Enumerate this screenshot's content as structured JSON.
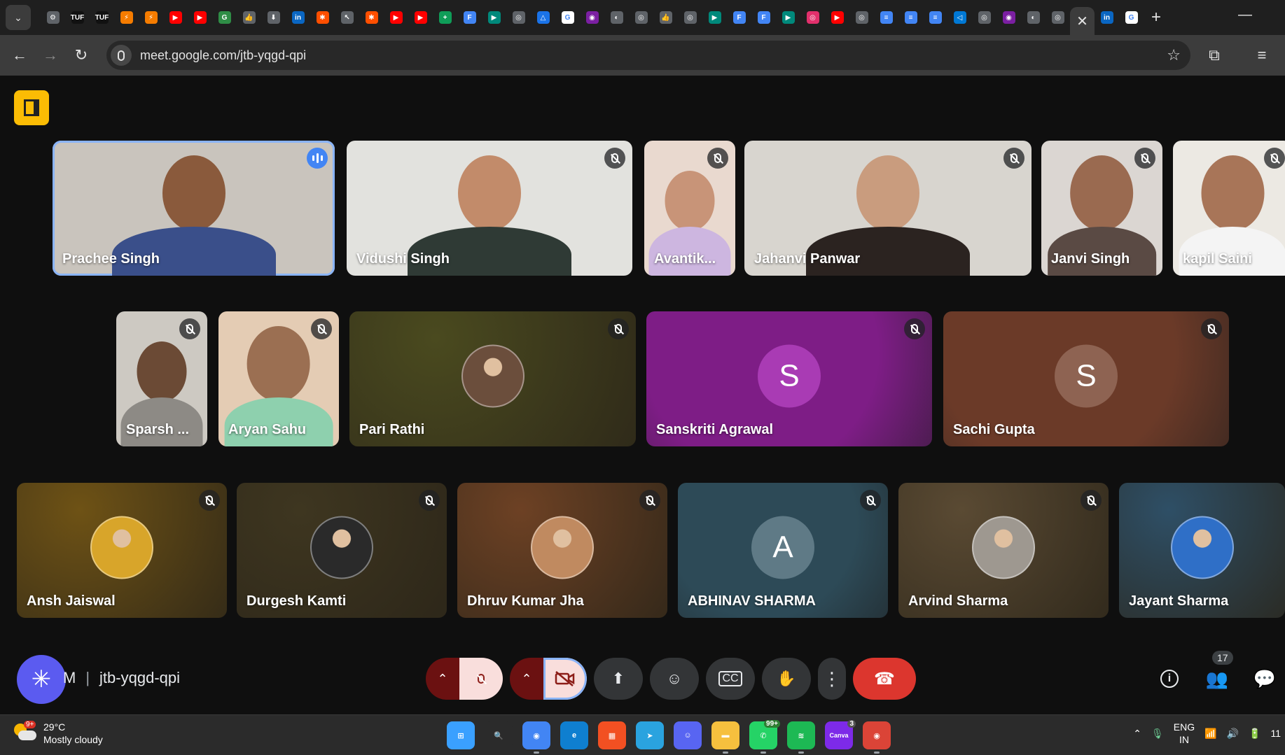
{
  "browser": {
    "tabs": [
      {
        "icon": "aperture-icon",
        "color": "#5f6368",
        "text": "⚙"
      },
      {
        "icon": "tuf-icon",
        "color": "#111111",
        "text": "TUF"
      },
      {
        "icon": "tuf-icon",
        "color": "#111111",
        "text": "TUF"
      },
      {
        "icon": "flow-icon",
        "color": "#f57c00",
        "text": "⚡"
      },
      {
        "icon": "flow-icon",
        "color": "#f57c00",
        "text": "⚡"
      },
      {
        "icon": "youtube-icon",
        "color": "#ff0000",
        "text": "▶"
      },
      {
        "icon": "youtube-icon",
        "color": "#ff0000",
        "text": "▶"
      },
      {
        "icon": "gfg-icon",
        "color": "#2f8d46",
        "text": "G"
      },
      {
        "icon": "thumbs-icon",
        "color": "#5f6368",
        "text": "👍"
      },
      {
        "icon": "download-icon",
        "color": "#5f6368",
        "text": "⬇"
      },
      {
        "icon": "linkedin-icon",
        "color": "#0a66c2",
        "text": "in"
      },
      {
        "icon": "zapier-icon",
        "color": "#ff4f00",
        "text": "✱"
      },
      {
        "icon": "cursor-icon",
        "color": "#5f6368",
        "text": "↖"
      },
      {
        "icon": "zapier-icon",
        "color": "#ff4f00",
        "text": "✱"
      },
      {
        "icon": "youtube-icon",
        "color": "#ff0000",
        "text": "▶"
      },
      {
        "icon": "youtube-icon",
        "color": "#ff0000",
        "text": "▶"
      },
      {
        "icon": "sheets-plus-icon",
        "color": "#0f9d58",
        "text": "+"
      },
      {
        "icon": "forms-icon",
        "color": "#4285f4",
        "text": "F"
      },
      {
        "icon": "meet-icon",
        "color": "#00897b",
        "text": "▶"
      },
      {
        "icon": "chatgpt-icon",
        "color": "#5f6368",
        "text": "◎"
      },
      {
        "icon": "drive-icon",
        "color": "#1a73e8",
        "text": "△"
      },
      {
        "icon": "google-icon",
        "color": "#ffffff",
        "text": "G"
      },
      {
        "icon": "circle-icon",
        "color": "#7b1fa2",
        "text": "◉"
      },
      {
        "icon": "globe-icon",
        "color": "#5f6368",
        "text": "◐"
      },
      {
        "icon": "chatgpt-icon",
        "color": "#5f6368",
        "text": "◎"
      },
      {
        "icon": "thumbs-icon",
        "color": "#5f6368",
        "text": "👍"
      },
      {
        "icon": "chatgpt-icon",
        "color": "#5f6368",
        "text": "◎"
      },
      {
        "icon": "meet-icon",
        "color": "#00897b",
        "text": "▶"
      },
      {
        "icon": "forms-icon",
        "color": "#4285f4",
        "text": "F"
      },
      {
        "icon": "forms-icon",
        "color": "#4285f4",
        "text": "F"
      },
      {
        "icon": "meet-icon",
        "color": "#00897b",
        "text": "▶"
      },
      {
        "icon": "instagram-icon",
        "color": "#e1306c",
        "text": "◎"
      },
      {
        "icon": "youtube-icon",
        "color": "#ff0000",
        "text": "▶"
      },
      {
        "icon": "chatgpt-icon",
        "color": "#5f6368",
        "text": "◎"
      },
      {
        "icon": "docs-icon",
        "color": "#4285f4",
        "text": "≡"
      },
      {
        "icon": "docs-icon",
        "color": "#4285f4",
        "text": "≡"
      },
      {
        "icon": "docs-icon",
        "color": "#4285f4",
        "text": "≡"
      },
      {
        "icon": "vscode-icon",
        "color": "#0078d4",
        "text": "◁"
      },
      {
        "icon": "chatgpt-icon",
        "color": "#5f6368",
        "text": "◎"
      },
      {
        "icon": "circle-icon",
        "color": "#7b1fa2",
        "text": "◉"
      },
      {
        "icon": "globe-icon",
        "color": "#5f6368",
        "text": "◐"
      },
      {
        "icon": "chatgpt-icon",
        "color": "#5f6368",
        "text": "◎"
      }
    ],
    "active_tab_close": "✕",
    "after_tabs": [
      {
        "icon": "linkedin-icon",
        "color": "#0a66c2",
        "text": "in"
      },
      {
        "icon": "google-icon",
        "color": "#ffffff",
        "text": "G"
      }
    ],
    "new_tab": "+",
    "minimize": "—",
    "url": "meet.google.com/jtb-yqgd-qpi"
  },
  "meet": {
    "row1": [
      {
        "name": "Prachee Singh",
        "speaking": true,
        "bg": "#c9c4bd",
        "skin": "#8a5a3c",
        "shirt": "#3a4f8a"
      },
      {
        "name": "Vidushi Singh",
        "muted": true,
        "bg": "#e2e2de",
        "skin": "#c28b6a",
        "shirt": "#2f3a35"
      },
      {
        "name": "Avantik...",
        "muted": true,
        "bg": "#e9d9cf",
        "skin": "#c89478",
        "shirt": "#cdb6e0"
      },
      {
        "name": "Jahanvi Panwar",
        "muted": true,
        "bg": "#d8d5cf",
        "skin": "#c99c7e",
        "shirt": "#2b2320"
      },
      {
        "name": "Janvi Singh",
        "muted": true,
        "bg": "#dbd6d2",
        "skin": "#9a6a50",
        "shirt": "#5a4a44"
      },
      {
        "name": "kapil Saini",
        "muted": true,
        "bg": "#ece9e3",
        "skin": "#a87558",
        "shirt": "#f4f4f4"
      }
    ],
    "row2": [
      {
        "name": "Sparsh ...",
        "muted": true,
        "bg": "#cdc9c2",
        "skin": "#6b4a35",
        "shirt": "#8d8a85"
      },
      {
        "name": "Aryan Sahu",
        "muted": true,
        "bg": "#e4ccb4",
        "skin": "#9b6f52",
        "shirt": "#8ed0ae"
      },
      {
        "name": "Pari Rathi",
        "muted": true,
        "bg": "#4a4a1f",
        "avatar": "photo",
        "avatar_color": "#6b4e3c"
      },
      {
        "name": "Sanskriti Agrawal",
        "muted": true,
        "bg": "#7e1d86",
        "letter": "S",
        "letter_bg": "#a93bb4"
      },
      {
        "name": "Sachi Gupta",
        "muted": true,
        "bg": "#6b3a28",
        "letter": "S",
        "letter_bg": "#8e6352"
      }
    ],
    "row3": [
      {
        "name": "Ansh Jaiswal",
        "muted": true,
        "bg": "#6e5215",
        "avatar": "photo",
        "avatar_color": "#d8a52a"
      },
      {
        "name": "Durgesh Kamti",
        "muted": true,
        "bg": "#3e3620",
        "avatar": "photo",
        "avatar_color": "#2a2a2a"
      },
      {
        "name": "Dhruv Kumar Jha",
        "muted": true,
        "bg": "#6d4124",
        "avatar": "photo",
        "avatar_color": "#c08a60"
      },
      {
        "name": "ABHINAV SHARMA",
        "muted": true,
        "bg": "#2d4a57",
        "letter": "A",
        "letter_bg": "#5f7a86"
      },
      {
        "name": "Arvind Sharma",
        "muted": true,
        "bg": "#5a4a33",
        "avatar": "photo",
        "avatar_color": "#9e9890"
      },
      {
        "name": "Jayant Sharma",
        "bg": "#2e4f66",
        "avatar": "photo",
        "avatar_color": "#2f6fc7"
      }
    ],
    "meeting_code": "jtb-yqgd-qpi",
    "time_fragment": "M",
    "people_count": "17"
  },
  "taskbar": {
    "temperature": "29°C",
    "weather": "Mostly cloudy",
    "weather_badge": "9+",
    "apps": [
      {
        "icon": "windows-start-icon",
        "color": "#3aa0ff",
        "text": "⊞"
      },
      {
        "icon": "search-icon",
        "color": "#2b2b2b",
        "text": "🔍"
      },
      {
        "icon": "chrome-icon",
        "color": "#4285f4",
        "text": "◉",
        "running": true
      },
      {
        "icon": "edge-icon",
        "color": "#0f7fd0",
        "text": "e"
      },
      {
        "icon": "ms-store-icon",
        "color": "#f25022",
        "text": "▦"
      },
      {
        "icon": "telegram-icon",
        "color": "#2aa3df",
        "text": "➤"
      },
      {
        "icon": "discord-icon",
        "color": "#5865f2",
        "text": "☺"
      },
      {
        "icon": "file-explorer-icon",
        "color": "#f6c03e",
        "text": "▬",
        "running": true
      },
      {
        "icon": "whatsapp-icon",
        "color": "#25d366",
        "text": "✆",
        "count": "99+",
        "running": true
      },
      {
        "icon": "spotify-icon",
        "color": "#1db954",
        "text": "≋",
        "running": true
      },
      {
        "icon": "canva-icon",
        "color": "#7d2ae8",
        "text": "Canva",
        "count": "3"
      },
      {
        "icon": "chrome-profile-icon",
        "color": "#db4437",
        "text": "◉",
        "running": true
      }
    ],
    "lang_top": "ENG",
    "lang_bottom": "IN",
    "clock_fragment": "11"
  }
}
